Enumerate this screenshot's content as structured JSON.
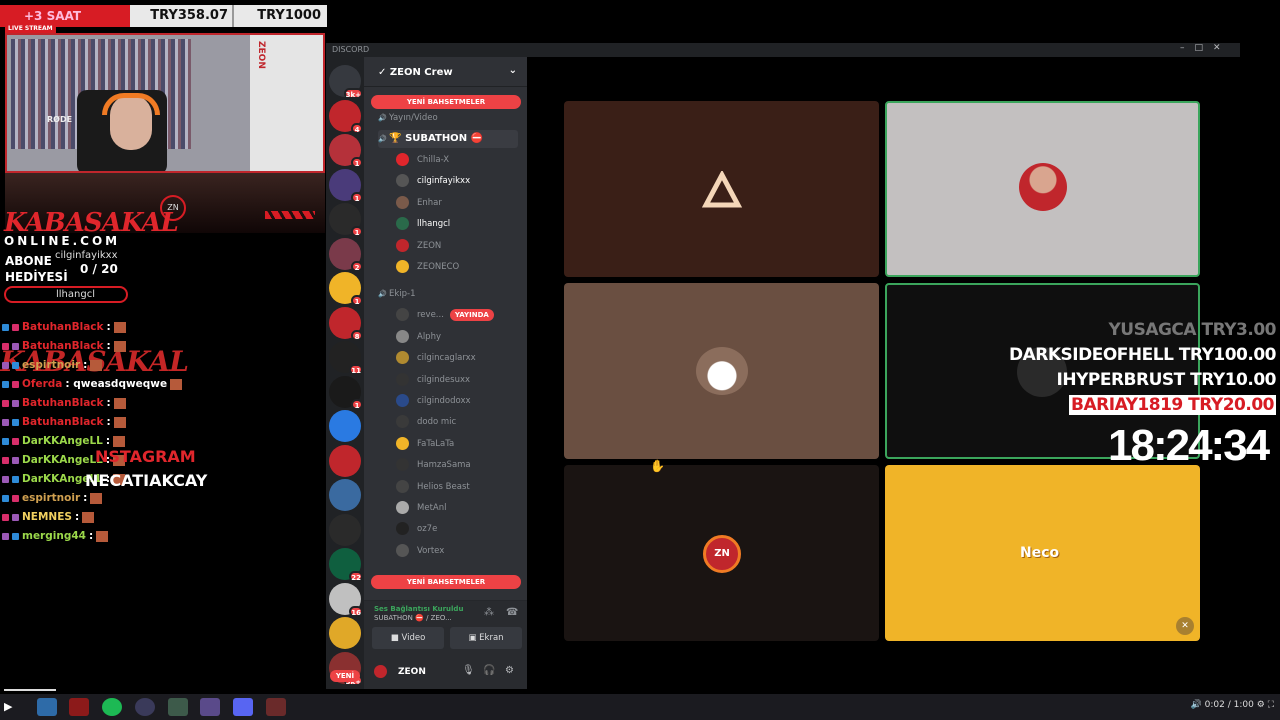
{
  "stream": {
    "goal": "+3 SAAT",
    "amount_total": "TRY358.07",
    "amount_goal": "TRY1000",
    "live_label": "LIVE STREAM",
    "cam_mic": "RØDE",
    "cam_side": "ZEON",
    "brand": "KABASAKAL",
    "brand_site": "ONLINE.COM",
    "abone_label": "ABONE HEDİYESİ",
    "sub_name": "cilginfayikxx",
    "sub_count": "0 / 20",
    "sub_user": "llhangcl"
  },
  "chat": [
    {
      "name": "BatuhanBlack",
      "text": ":",
      "color": "#e0262c"
    },
    {
      "name": "BatuhanBlack",
      "text": ":",
      "color": "#e0262c"
    },
    {
      "name": "espirtnoir",
      "text": ":",
      "color": "#d0a050"
    },
    {
      "name": "Oferda",
      "text": ": qweasdqweqwe",
      "color": "#e0262c"
    },
    {
      "name": "BatuhanBlack",
      "text": ":",
      "color": "#e0262c"
    },
    {
      "name": "BatuhanBlack",
      "text": ":",
      "color": "#e0262c"
    },
    {
      "name": "DarKKAngeLL",
      "text": ":",
      "color": "#9bd84a"
    },
    {
      "name": "DarKKAngeLL",
      "text": ":",
      "color": "#9bd84a"
    },
    {
      "name": "DarKKAngeLL",
      "text": ":",
      "color": "#9bd84a"
    },
    {
      "name": "espirtnoir",
      "text": ":",
      "color": "#d0a050"
    },
    {
      "name": "NEMNES",
      "text": ":",
      "color": "#f0d060"
    },
    {
      "name": "merging44",
      "text": ":",
      "color": "#9bd84a"
    }
  ],
  "chat_overlay": {
    "brand": "KABASAKAL",
    "insta_label": "NSTAGRAM",
    "insta_handle": "NECATIAKCAY"
  },
  "discord": {
    "title": "DISCORD",
    "guild": "ZEON Crew",
    "new_mentions": "YENİ BAHSETMELER",
    "channels": [
      {
        "type": "voice",
        "label": "Yayın/Video"
      },
      {
        "type": "voice",
        "label": "🏆 SUBATHON ⛔",
        "active": true
      },
      {
        "type": "user",
        "label": "Chilla-X"
      },
      {
        "type": "user",
        "label": "cilginfayikxx",
        "bright": true
      },
      {
        "type": "user",
        "label": "Enhar"
      },
      {
        "type": "user",
        "label": "llhangcl",
        "bright": true
      },
      {
        "type": "user",
        "label": "ZEON"
      },
      {
        "type": "user",
        "label": "ZEONECO"
      },
      {
        "type": "voice",
        "label": "Ekip-1"
      },
      {
        "type": "user",
        "label": "reve...",
        "tag": "YAYINDA"
      },
      {
        "type": "user",
        "label": "Alphy"
      },
      {
        "type": "user",
        "label": "cilgincaglarxx"
      },
      {
        "type": "user",
        "label": "cilgindesuxx"
      },
      {
        "type": "user",
        "label": "cilgindodoxx"
      },
      {
        "type": "user",
        "label": "dodo mic"
      },
      {
        "type": "user",
        "label": "FaTaLaTa"
      },
      {
        "type": "user",
        "label": "HamzaSama"
      },
      {
        "type": "user",
        "label": "Helios Beast"
      },
      {
        "type": "user",
        "label": "MetAnl"
      },
      {
        "type": "user",
        "label": "oz7e"
      },
      {
        "type": "user",
        "label": "Vortex"
      }
    ],
    "voice_status": "Ses Bağlantısı Kuruldu",
    "voice_channel": "SUBATHON ⛔ / ZEO...",
    "video_btn": "Video",
    "screen_btn": "Ekran",
    "username": "ZEON",
    "server_badges": [
      "3k+",
      "4",
      "1",
      "1",
      "1",
      "2",
      "1",
      "8",
      "11",
      "1",
      "",
      "",
      "",
      "",
      "22",
      "16",
      "",
      "3k+"
    ],
    "new_label": "YENİ",
    "tiles": [
      "neco-tile"
    ]
  },
  "tile_logo": "Neco",
  "donations": [
    {
      "text": "YUSAGCA  TRY3.00",
      "style": "dim"
    },
    {
      "text": "DARKSIDEOFHELL  TRY100.00",
      "style": "white"
    },
    {
      "text": "IHYPERBRUST  TRY10.00",
      "style": "white"
    },
    {
      "text": "BARIAY1819  TRY20.00",
      "style": "red"
    }
  ],
  "clock": "18:24:34",
  "player": {
    "time": "0:02 / 1:00"
  },
  "colors": {
    "accent": "#ed4245",
    "discord_bg": "#2f3136",
    "neco": "#f0b428"
  }
}
